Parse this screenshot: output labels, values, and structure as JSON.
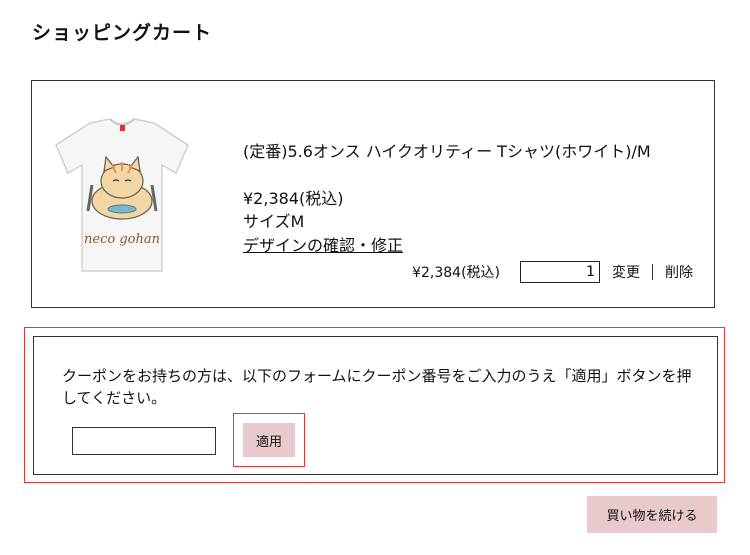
{
  "page": {
    "title": "ショッピングカート"
  },
  "cart": {
    "item": {
      "name": "(定番)5.6オンス ハイクオリティー Tシャツ(ホワイト)/M",
      "price": "¥2,384(税込)",
      "size": "サイズM",
      "design_link": "デザインの確認・修正",
      "image_text": "neco gohan",
      "line_price": "¥2,384(税込)",
      "quantity": "1",
      "change_label": "変更",
      "delete_label": "削除"
    }
  },
  "coupon": {
    "instruction": "クーポンをお持ちの方は、以下のフォームにクーポン番号をご入力のうえ「適用」ボタンを押してください。",
    "input_value": "",
    "apply_label": "適用"
  },
  "actions": {
    "continue_label": "買い物を続ける"
  }
}
